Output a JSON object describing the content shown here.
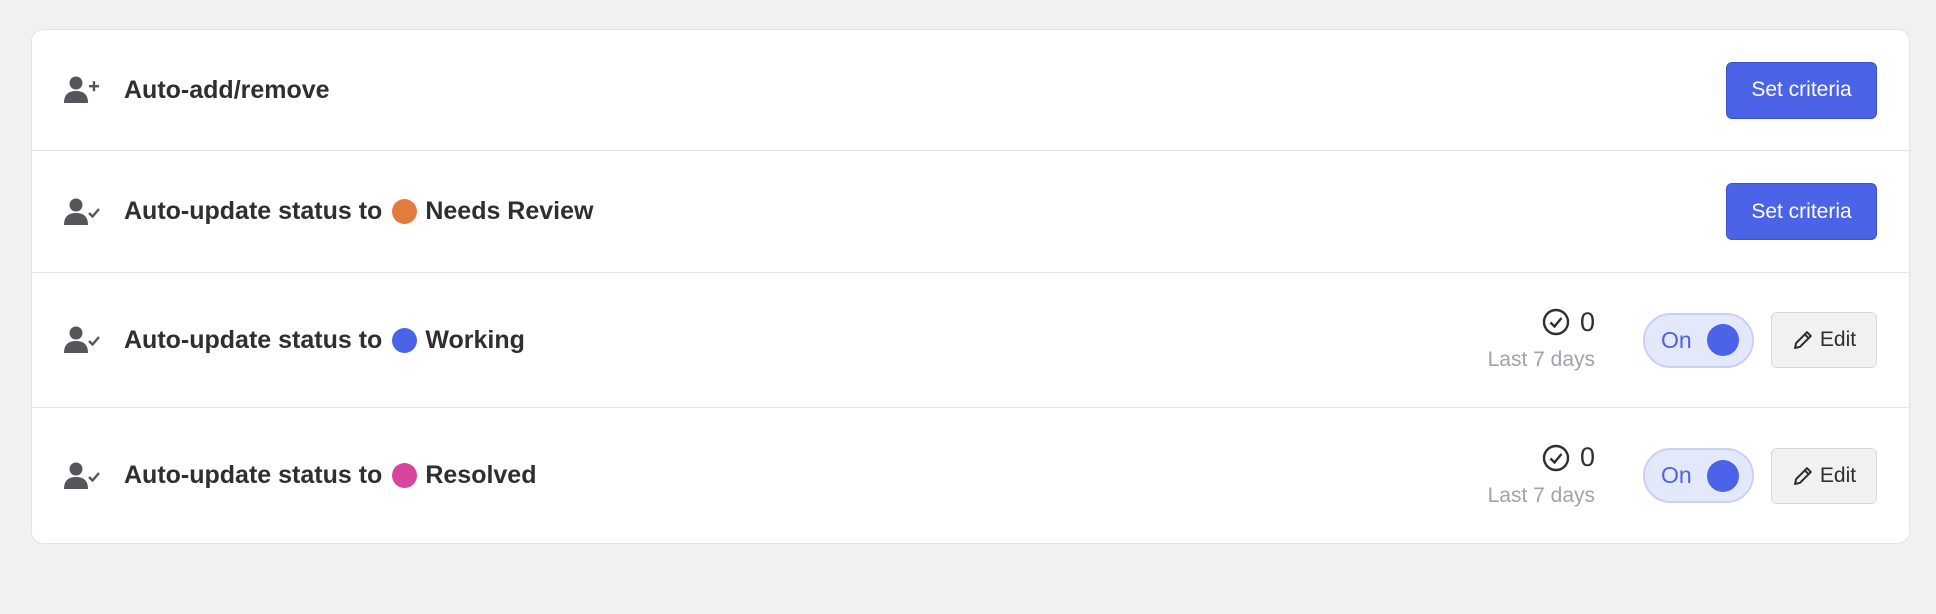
{
  "rules": [
    {
      "icon": "user-plus-icon",
      "title": "Auto-add/remove",
      "action_label": "Set criteria"
    },
    {
      "icon": "user-check-icon",
      "title": "Auto-update status to",
      "status_name": "Needs Review",
      "status_color": "#e27b3e",
      "action_label": "Set criteria"
    },
    {
      "icon": "user-check-icon",
      "title": "Auto-update status to",
      "status_name": "Working",
      "status_color": "#4a63e7",
      "count": "0",
      "period": "Last 7 days",
      "toggle_label": "On",
      "edit_label": "Edit"
    },
    {
      "icon": "user-check-icon",
      "title": "Auto-update status to",
      "status_name": "Resolved",
      "status_color": "#d9459e",
      "count": "0",
      "period": "Last 7 days",
      "toggle_label": "On",
      "edit_label": "Edit"
    }
  ],
  "colors": {
    "primary": "#4a63e7",
    "background": "#f0f1f3",
    "muted_text": "#a0a3a9"
  }
}
